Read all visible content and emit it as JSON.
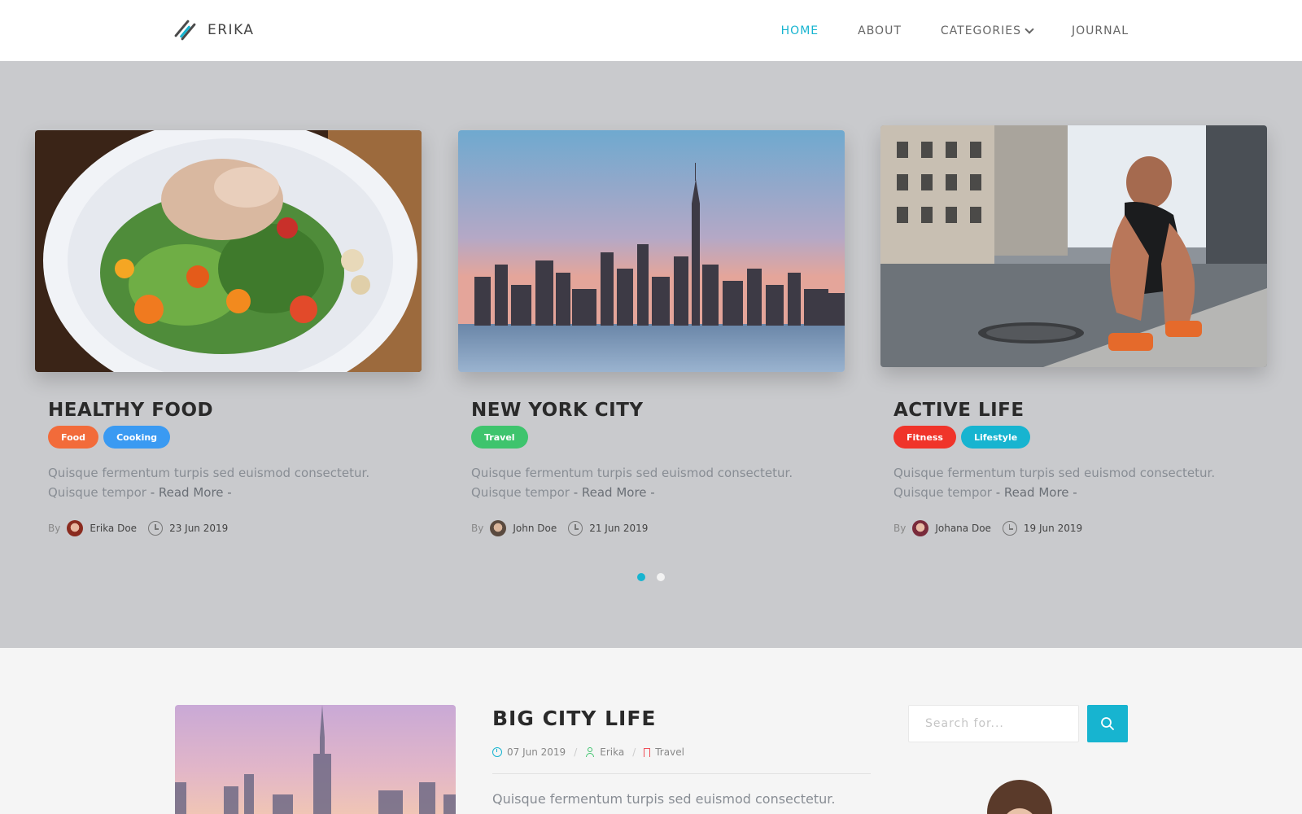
{
  "brand": {
    "name": "ERIKA"
  },
  "nav": [
    {
      "label": "HOME",
      "active": true
    },
    {
      "label": "ABOUT",
      "active": false
    },
    {
      "label": "CATEGORIES",
      "active": false,
      "has_dropdown": true
    },
    {
      "label": "JOURNAL",
      "active": false
    }
  ],
  "cards": [
    {
      "title": "HEALTHY FOOD",
      "tags": [
        {
          "label": "Food",
          "color": "#f26b3a"
        },
        {
          "label": "Cooking",
          "color": "#3a9af2"
        }
      ],
      "text": "Quisque fermentum turpis sed euismod consectetur. Quisque tempor",
      "read_more": "- Read More -",
      "by_label": "By",
      "author": "Erika Doe",
      "date": "23 Jun 2019"
    },
    {
      "title": "NEW YORK CITY",
      "tags": [
        {
          "label": "Travel",
          "color": "#3ec46d"
        }
      ],
      "text": "Quisque fermentum turpis sed euismod consectetur. Quisque tempor",
      "read_more": "- Read More -",
      "by_label": "By",
      "author": "John Doe",
      "date": "21 Jun 2019"
    },
    {
      "title": "ACTIVE LIFE",
      "tags": [
        {
          "label": "Fitness",
          "color": "#f0342a"
        },
        {
          "label": "Lifestyle",
          "color": "#17b4d0"
        }
      ],
      "text": "Quisque fermentum turpis sed euismod consectetur. Quisque tempor",
      "read_more": "- Read More -",
      "by_label": "By",
      "author": "Johana Doe",
      "date": "19 Jun 2019"
    }
  ],
  "carousel": {
    "pages": 2,
    "active_page": 1
  },
  "post": {
    "title": "BIG CITY LIFE",
    "date": "07 Jun 2019",
    "author": "Erika",
    "category": "Travel",
    "excerpt": "Quisque fermentum turpis sed euismod consectetur."
  },
  "search": {
    "placeholder": "Search for..."
  },
  "colors": {
    "accent": "#17b4d0",
    "hero_bg": "#c9cacd",
    "page_bg": "#f5f5f5"
  },
  "icons": {
    "search": "search-icon",
    "clock": "clock-icon",
    "user": "user-icon",
    "bookmark": "bookmark-icon"
  }
}
